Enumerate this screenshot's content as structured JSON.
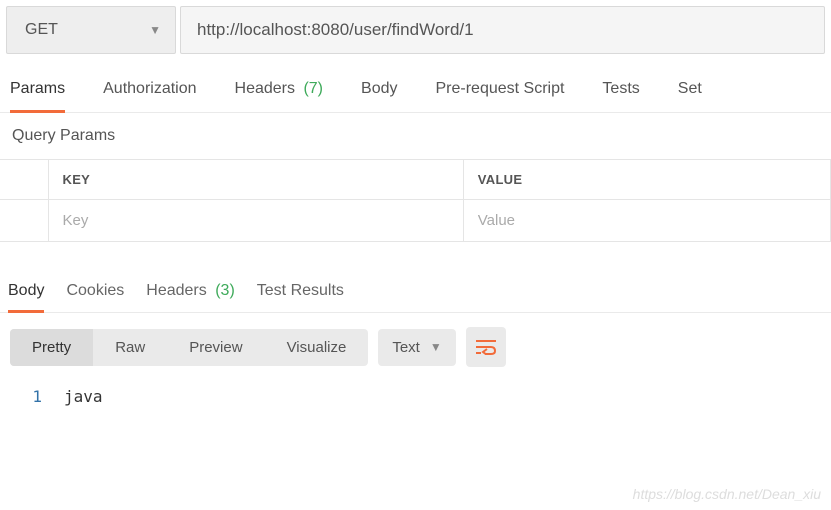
{
  "request": {
    "method": "GET",
    "url": "http://localhost:8080/user/findWord/1"
  },
  "tabs": {
    "params": "Params",
    "authorization": "Authorization",
    "headers_label": "Headers",
    "headers_count": "(7)",
    "body": "Body",
    "prerequest": "Pre-request Script",
    "tests": "Tests",
    "settings": "Set"
  },
  "params_section": {
    "title": "Query Params",
    "header_key": "KEY",
    "header_value": "VALUE",
    "placeholder_key": "Key",
    "placeholder_value": "Value"
  },
  "response_tabs": {
    "body": "Body",
    "cookies": "Cookies",
    "headers_label": "Headers",
    "headers_count": "(3)",
    "test_results": "Test Results"
  },
  "response_toolbar": {
    "pretty": "Pretty",
    "raw": "Raw",
    "preview": "Preview",
    "visualize": "Visualize",
    "format": "Text"
  },
  "response_body": {
    "line_no": "1",
    "content": "java"
  },
  "watermark": "https://blog.csdn.net/Dean_xiu"
}
